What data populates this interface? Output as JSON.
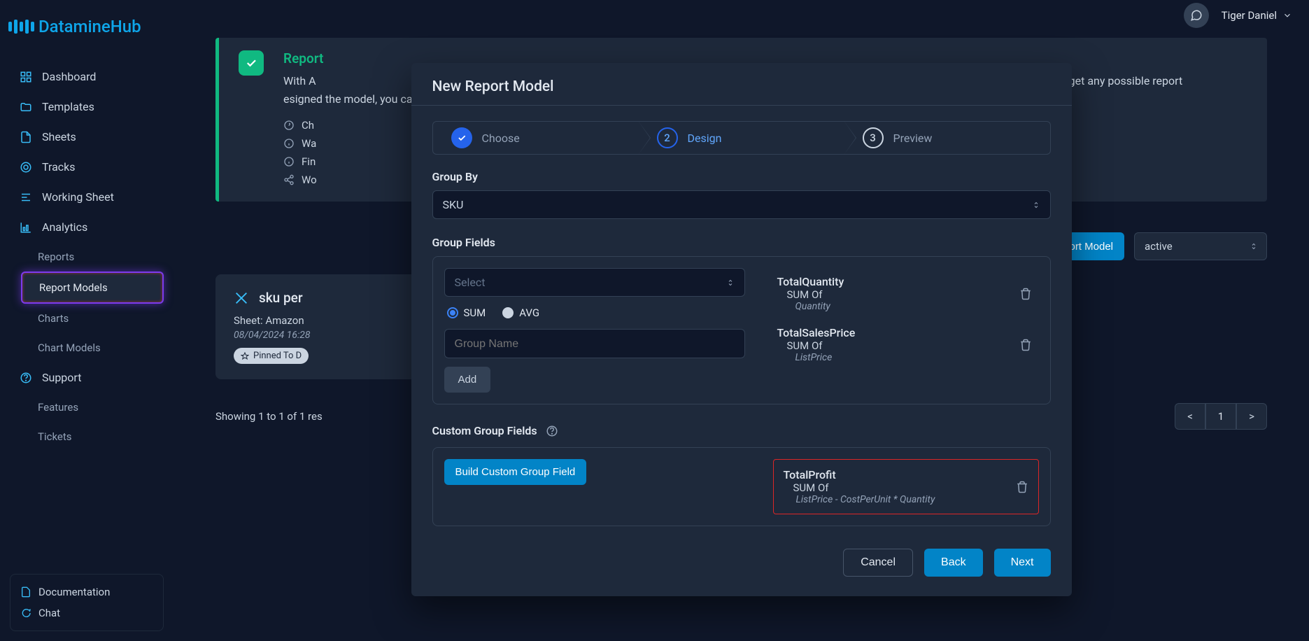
{
  "app": {
    "name": "DatamineHub"
  },
  "user": {
    "name": "Tiger Daniel"
  },
  "nav": {
    "dashboard": "Dashboard",
    "templates": "Templates",
    "sheets": "Sheets",
    "tracks": "Tracks",
    "working_sheet": "Working Sheet",
    "analytics": "Analytics",
    "reports": "Reports",
    "report_models": "Report Models",
    "charts": "Charts",
    "chart_models": "Chart Models",
    "support": "Support",
    "features": "Features",
    "tickets": "Tickets"
  },
  "footer": {
    "documentation": "Documentation",
    "chat": "Chat"
  },
  "banner": {
    "title": "Report",
    "desc_1": "With A",
    "desc_2": "esigner. Follow it and you will get any possible report",
    "desc_3": "esigned the model, you can view your report on the 'R",
    "items": [
      "Ch",
      "Wa",
      "Fin",
      "Wo"
    ]
  },
  "action": {
    "new_report_model": "New Report Model",
    "filter_value": "active"
  },
  "card": {
    "title": "sku per",
    "sheet_label": "Sheet: Amazon",
    "date": "08/04/2024 16:28",
    "badge": "Pinned To D"
  },
  "results": {
    "text": "Showing 1 to 1 of 1 res",
    "prev": "<",
    "page": "1",
    "next": ">"
  },
  "modal": {
    "title": "New Report Model",
    "steps": {
      "choose": "Choose",
      "design": "Design",
      "preview": "Preview"
    },
    "group_by": {
      "label": "Group By",
      "value": "SKU"
    },
    "group_fields": {
      "label": "Group Fields",
      "select_placeholder": "Select",
      "sum": "SUM",
      "avg": "AVG",
      "name_placeholder": "Group Name",
      "add": "Add",
      "fields": [
        {
          "name": "TotalQuantity",
          "agg": "SUM Of",
          "src": "Quantity"
        },
        {
          "name": "TotalSalesPrice",
          "agg": "SUM Of",
          "src": "ListPrice"
        }
      ]
    },
    "custom": {
      "label": "Custom Group Fields",
      "build": "Build Custom Group Field",
      "field": {
        "name": "TotalProfit",
        "agg": "SUM Of",
        "src": "ListPrice - CostPerUnit * Quantity"
      }
    },
    "buttons": {
      "cancel": "Cancel",
      "back": "Back",
      "next": "Next"
    }
  }
}
